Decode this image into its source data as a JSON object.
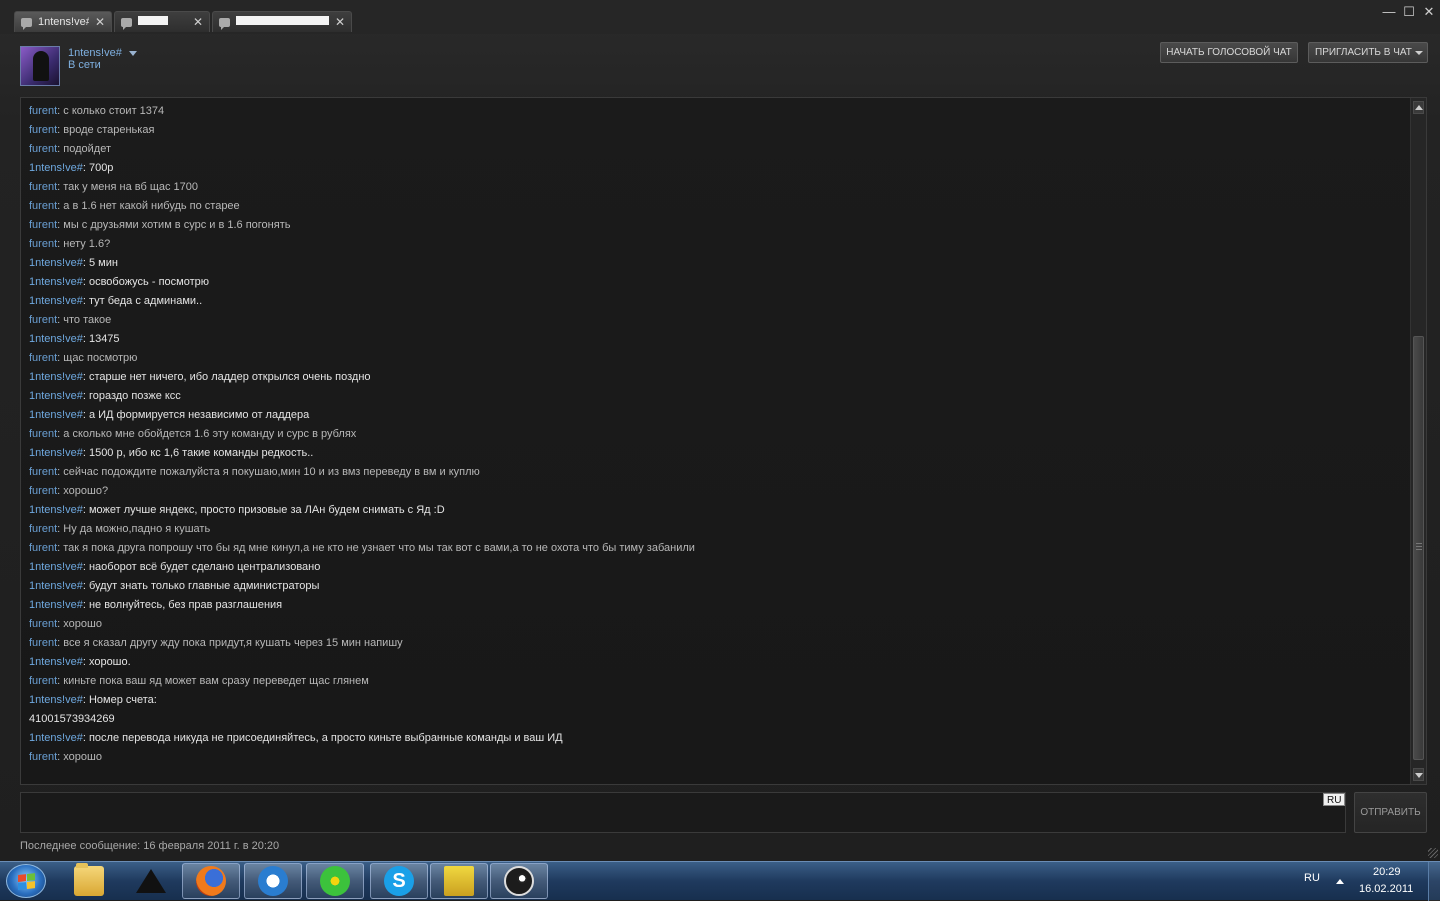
{
  "tabs": [
    {
      "label": "1ntens!ve#",
      "active": true,
      "redacted": false
    },
    {
      "label": "",
      "active": false,
      "redacted": true
    },
    {
      "label": "",
      "active": false,
      "redacted": true
    }
  ],
  "window_controls": {
    "minimize": "—",
    "maximize": "☐",
    "close": "✕"
  },
  "header": {
    "user_name": "1ntens!ve#",
    "user_status": "В сети",
    "voice_chat_button": "НАЧАТЬ ГОЛОСОВОЙ ЧАТ",
    "invite_button": "ПРИГЛАСИТЬ В ЧАТ"
  },
  "messages": [
    {
      "sender": "furent",
      "text": "с колько стоит 1374",
      "self": false
    },
    {
      "sender": "furent",
      "text": "вроде старенькая",
      "self": false
    },
    {
      "sender": "furent",
      "text": "подойдет",
      "self": false
    },
    {
      "sender": "1ntens!ve#",
      "text": "700р",
      "self": true
    },
    {
      "sender": "furent",
      "text": "так у меня на вб щас 1700",
      "self": false
    },
    {
      "sender": "furent",
      "text": "а в 1.6 нет какой нибудь по старее",
      "self": false
    },
    {
      "sender": "furent",
      "text": "мы с друзьями хотим в сурс и в 1.6 погонять",
      "self": false
    },
    {
      "sender": "furent",
      "text": "нету 1.6?",
      "self": false
    },
    {
      "sender": "1ntens!ve#",
      "text": "5 мин",
      "self": true
    },
    {
      "sender": "1ntens!ve#",
      "text": "освобожусь - посмотрю",
      "self": true
    },
    {
      "sender": "1ntens!ve#",
      "text": "тут беда с админами..",
      "self": true
    },
    {
      "sender": "furent",
      "text": "что такое",
      "self": false
    },
    {
      "sender": "1ntens!ve#",
      "text": "13475",
      "self": true
    },
    {
      "sender": "furent",
      "text": "щас посмотрю",
      "self": false
    },
    {
      "sender": "1ntens!ve#",
      "text": "старше нет ничего, ибо ладдер открылся очень поздно",
      "self": true
    },
    {
      "sender": "1ntens!ve#",
      "text": "гораздо позже ксс",
      "self": true
    },
    {
      "sender": "1ntens!ve#",
      "text": "а ИД формируется независимо от ладдера",
      "self": true
    },
    {
      "sender": "furent",
      "text": "а сколько мне обойдется 1.6 эту команду и сурс в рублях",
      "self": false
    },
    {
      "sender": "1ntens!ve#",
      "text": "1500 р, ибо кс 1,6 такие команды редкость..",
      "self": true
    },
    {
      "sender": "furent",
      "text": "сейчас подождите пожалуйста я покушаю,мин 10 и из вмз переведу в вм и куплю",
      "self": false
    },
    {
      "sender": "furent",
      "text": "хорошо?",
      "self": false
    },
    {
      "sender": "1ntens!ve#",
      "text": "может лучше яндекс, просто призовые за ЛАн будем снимать с Яд :D",
      "self": true
    },
    {
      "sender": "furent",
      "text": "Ну да можно,падно я кушать",
      "self": false
    },
    {
      "sender": "furent",
      "text": "так я пока друга попрошу что бы яд мне кинул,а не кто не узнает что мы так вот с вами,а то не охота что бы тиму забанили",
      "self": false
    },
    {
      "sender": "1ntens!ve#",
      "text": "наоборот всё будет сделано централизовано",
      "self": true
    },
    {
      "sender": "1ntens!ve#",
      "text": "будут знать только главные администраторы",
      "self": true
    },
    {
      "sender": "1ntens!ve#",
      "text": "не волнуйтесь, без прав разглашения",
      "self": true
    },
    {
      "sender": "furent",
      "text": "хорошо",
      "self": false
    },
    {
      "sender": "furent",
      "text": "все я сказал другу жду пока придут,я кушать через 15 мин напишу",
      "self": false
    },
    {
      "sender": "1ntens!ve#",
      "text": "хорошо.",
      "self": true
    },
    {
      "sender": "furent",
      "text": "киньте пока ваш яд может вам сразу переведет щас глянем",
      "self": false
    },
    {
      "sender": "1ntens!ve#",
      "text": "Номер счета:",
      "self": true
    },
    {
      "sender": "",
      "text": "41001573934269",
      "self": true
    },
    {
      "sender": "1ntens!ve#",
      "text": "после перевода никуда не присоединяйтесь, а просто киньте выбранные команды и ваш ИД",
      "self": true
    },
    {
      "sender": "furent",
      "text": "хорошо",
      "self": false
    }
  ],
  "input": {
    "lang_badge": "RU",
    "send_button": "ОТПРАВИТЬ",
    "value": ""
  },
  "footer": {
    "last_message": "Последнее сообщение: 16 февраля 2011 г. в 20:20"
  },
  "taskbar": {
    "icons": [
      "folder-icon",
      "aimp-icon",
      "firefox-icon",
      "maxthon-icon",
      "icq-icon",
      "skype-icon",
      "punkbuster-icon",
      "steam-icon"
    ],
    "active_icon": "steam-icon",
    "tray_lang": "RU",
    "clock_time": "20:29",
    "clock_date": "16.02.2011"
  }
}
